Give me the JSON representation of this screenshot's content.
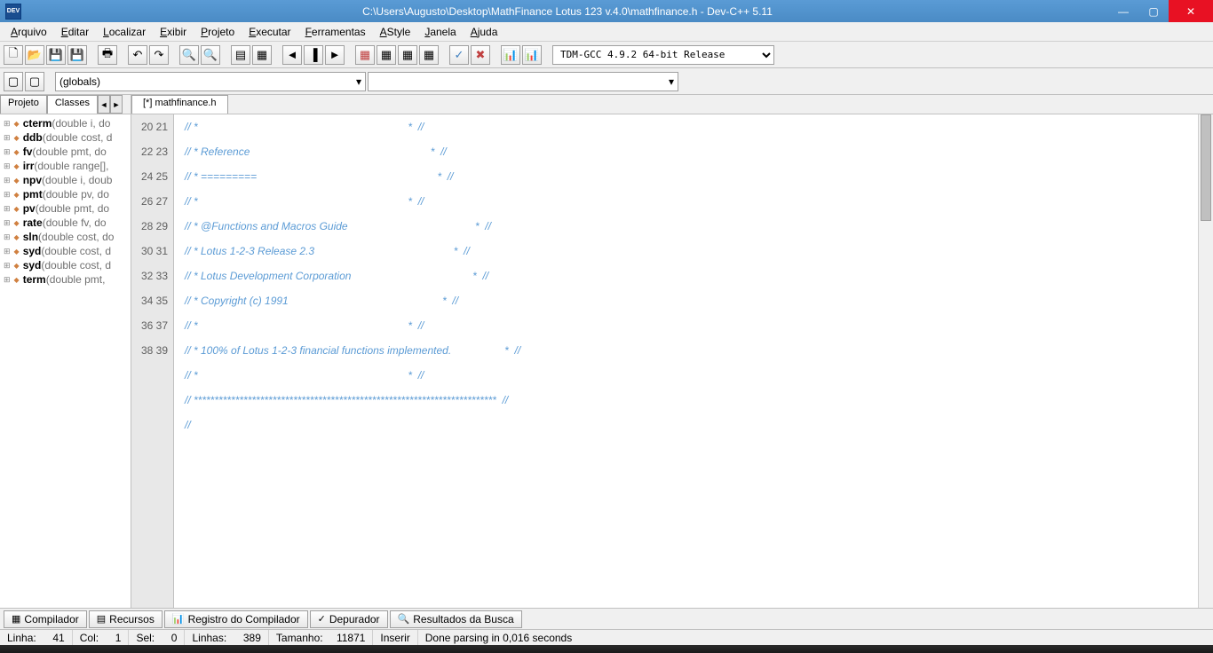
{
  "window": {
    "title": "C:\\Users\\Augusto\\Desktop\\MathFinance Lotus 123 v.4.0\\mathfinance.h - Dev-C++ 5.11"
  },
  "menu": [
    "Arquivo",
    "Editar",
    "Localizar",
    "Exibir",
    "Projeto",
    "Executar",
    "Ferramentas",
    "AStyle",
    "Janela",
    "Ajuda"
  ],
  "compiler_select": "TDM-GCC 4.9.2 64-bit Release",
  "scope_select": "(globals)",
  "lefttabs": {
    "projeto": "Projeto",
    "classes": "Classes"
  },
  "classes": [
    {
      "name": "cterm",
      "sig": "(double i, do"
    },
    {
      "name": "ddb",
      "sig": "(double cost, d"
    },
    {
      "name": "fv",
      "sig": "(double pmt, do"
    },
    {
      "name": "irr",
      "sig": "(double range[],"
    },
    {
      "name": "npv",
      "sig": "(double i, doub"
    },
    {
      "name": "pmt",
      "sig": "(double pv, do"
    },
    {
      "name": "pv",
      "sig": "(double pmt, do"
    },
    {
      "name": "rate",
      "sig": "(double fv, do"
    },
    {
      "name": "sln",
      "sig": "(double cost, do"
    },
    {
      "name": "syd",
      "sig": "(double cost, d"
    },
    {
      "name": "syd",
      "sig": "(double cost, d"
    },
    {
      "name": "term",
      "sig": "(double pmt,"
    }
  ],
  "editor_tab": "[*] mathfinance.h",
  "code_start_line": 20,
  "code_lines": [
    "// *                                                                       *  //",
    "// * Reference                                                             *  //",
    "// * =========                                                             *  //",
    "// *                                                                       *  //",
    "// * @Functions and Macros Guide                                           *  //",
    "// * Lotus 1-2-3 Release 2.3                                               *  //",
    "// * Lotus Development Corporation                                         *  //",
    "// * Copyright (c) 1991                                                    *  //",
    "// *                                                                       *  //",
    "// * 100% of Lotus 1-2-3 financial functions implemented.                  *  //",
    "// *                                                                       *  //",
    "// *************************************************************************  //",
    "//",
    "",
    "",
    "",
    "",
    "",
    "",
    ""
  ],
  "bottom_tabs": [
    {
      "icon": "▦",
      "label": "Compilador"
    },
    {
      "icon": "▤",
      "label": "Recursos"
    },
    {
      "icon": "📊",
      "label": "Registro do Compilador"
    },
    {
      "icon": "✓",
      "label": "Depurador"
    },
    {
      "icon": "🔍",
      "label": "Resultados da Busca"
    }
  ],
  "status": {
    "linha_l": "Linha:",
    "linha": "41",
    "col_l": "Col:",
    "col": "1",
    "sel_l": "Sel:",
    "sel": "0",
    "linhas_l": "Linhas:",
    "linhas": "389",
    "tam_l": "Tamanho:",
    "tam": "11871",
    "mode": "Inserir",
    "msg": "Done parsing in 0,016 seconds"
  }
}
